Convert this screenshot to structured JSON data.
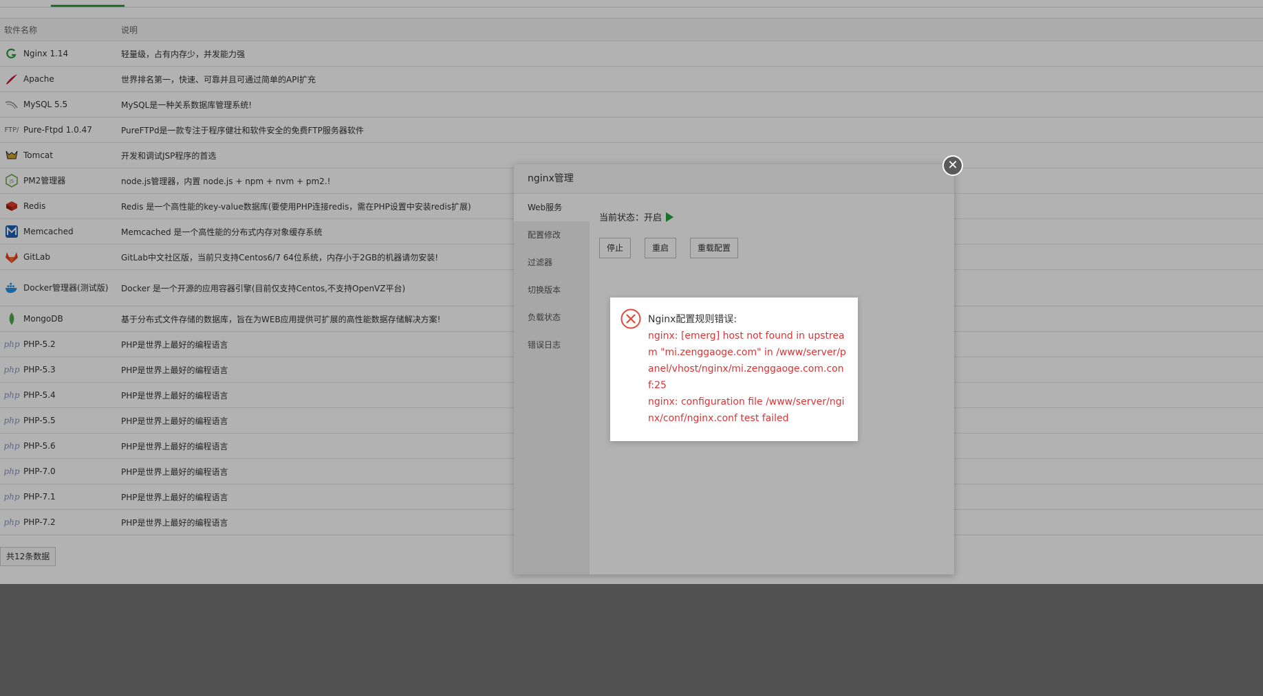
{
  "table": {
    "headers": {
      "name": "软件名称",
      "desc": "说明"
    },
    "rows": [
      {
        "name": "Nginx 1.14",
        "desc": "轻量级，占有内存少，并发能力强",
        "icon": "nginx-icon"
      },
      {
        "name": "Apache",
        "desc": "世界排名第一，快速、可靠并且可通过简单的API扩充",
        "icon": "apache-feather-icon"
      },
      {
        "name": "MySQL 5.5",
        "desc": "MySQL是一种关系数据库管理系统!",
        "icon": "mysql-dolphin-icon"
      },
      {
        "name": "Pure-Ftpd 1.0.47",
        "desc": "PureFTPd是一款专注于程序健壮和软件安全的免费FTP服务器软件",
        "icon": "ftp-icon",
        "icon_text": "FTP/"
      },
      {
        "name": "Tomcat",
        "desc": "开发和调试JSP程序的首选",
        "icon": "tomcat-icon"
      },
      {
        "name": "PM2管理器",
        "desc": "node.js管理器，内置 node.js + npm + nvm + pm2.!",
        "icon": "nodejs-icon"
      },
      {
        "name": "Redis",
        "desc": "Redis 是一个高性能的key-value数据库(要使用PHP连接redis，需在PHP设置中安装redis扩展)",
        "icon": "redis-icon"
      },
      {
        "name": "Memcached",
        "desc": "Memcached 是一个高性能的分布式内存对象缓存系统",
        "icon": "memcached-icon"
      },
      {
        "name": "GitLab",
        "desc": "GitLab中文社区版，当前只支持Centos6/7 64位系统，内存小于2GB的机器请勿安装!",
        "icon": "gitlab-fox-icon"
      },
      {
        "name": "Docker管理器(测试版)",
        "desc": "Docker 是一个开源的应用容器引擎(目前仅支持Centos,不支持OpenVZ平台)",
        "icon": "docker-whale-icon"
      },
      {
        "name": "MongoDB",
        "desc": "基于分布式文件存储的数据库，旨在为WEB应用提供可扩展的高性能数据存储解决方案!",
        "icon": "mongodb-leaf-icon"
      },
      {
        "name": "PHP-5.2",
        "desc": "PHP是世界上最好的编程语言",
        "icon": "php-icon",
        "icon_text": "php"
      },
      {
        "name": "PHP-5.3",
        "desc": "PHP是世界上最好的编程语言",
        "icon": "php-icon",
        "icon_text": "php"
      },
      {
        "name": "PHP-5.4",
        "desc": "PHP是世界上最好的编程语言",
        "icon": "php-icon",
        "icon_text": "php"
      },
      {
        "name": "PHP-5.5",
        "desc": "PHP是世界上最好的编程语言",
        "icon": "php-icon",
        "icon_text": "php"
      },
      {
        "name": "PHP-5.6",
        "desc": "PHP是世界上最好的编程语言",
        "icon": "php-icon",
        "icon_text": "php"
      },
      {
        "name": "PHP-7.0",
        "desc": "PHP是世界上最好的编程语言",
        "icon": "php-icon",
        "icon_text": "php"
      },
      {
        "name": "PHP-7.1",
        "desc": "PHP是世界上最好的编程语言",
        "icon": "php-icon",
        "icon_text": "php"
      },
      {
        "name": "PHP-7.2",
        "desc": "PHP是世界上最好的编程语言",
        "icon": "php-icon",
        "icon_text": "php"
      }
    ]
  },
  "pager": {
    "total": "共12条数据"
  },
  "modal": {
    "title": "nginx管理",
    "tabs": [
      "Web服务",
      "配置修改",
      "过滤器",
      "切换版本",
      "负载状态",
      "错误日志"
    ],
    "status_label": "当前状态：开启",
    "buttons": {
      "stop": "停止",
      "restart": "重启",
      "reload": "重载配置"
    }
  },
  "alert": {
    "heading": "Nginx配置规则错误:",
    "line1": "nginx: [emerg] host not found in upstream \"mi.zenggaoge.com\" in /www/server/panel/vhost/nginx/mi.zenggaoge.com.conf:25",
    "line2": "nginx: configuration file /www/server/nginx/conf/nginx.conf test failed"
  },
  "colors": {
    "accent": "#20a53a",
    "error": "#dd3333"
  }
}
